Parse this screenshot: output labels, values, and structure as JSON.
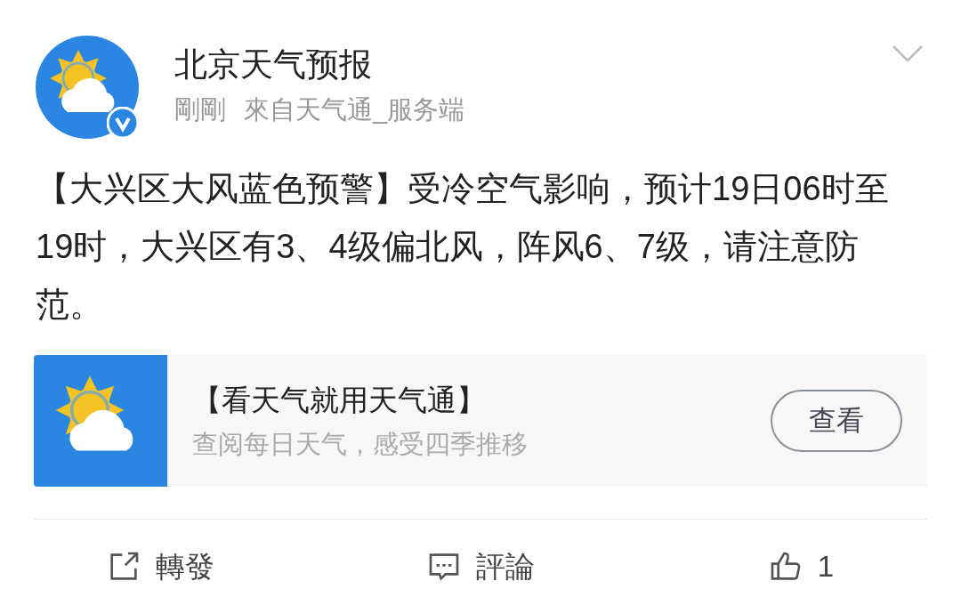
{
  "post": {
    "author": "北京天气预报",
    "time": "剛剛",
    "source": "來自天气通_服务端",
    "verified": true,
    "body": "【大兴区大风蓝色预警】受冷空气影响，预计19日06时至19时，大兴区有3、4级偏北风，阵风6、7级，请注意防范。"
  },
  "card": {
    "title": "【看天气就用天气通】",
    "subtitle": "查阅每日天气，感受四季推移",
    "button": "查看"
  },
  "actions": [
    {
      "kind": "share",
      "label": "轉發"
    },
    {
      "kind": "comment",
      "label": "評論"
    },
    {
      "kind": "like",
      "label": "1"
    }
  ]
}
